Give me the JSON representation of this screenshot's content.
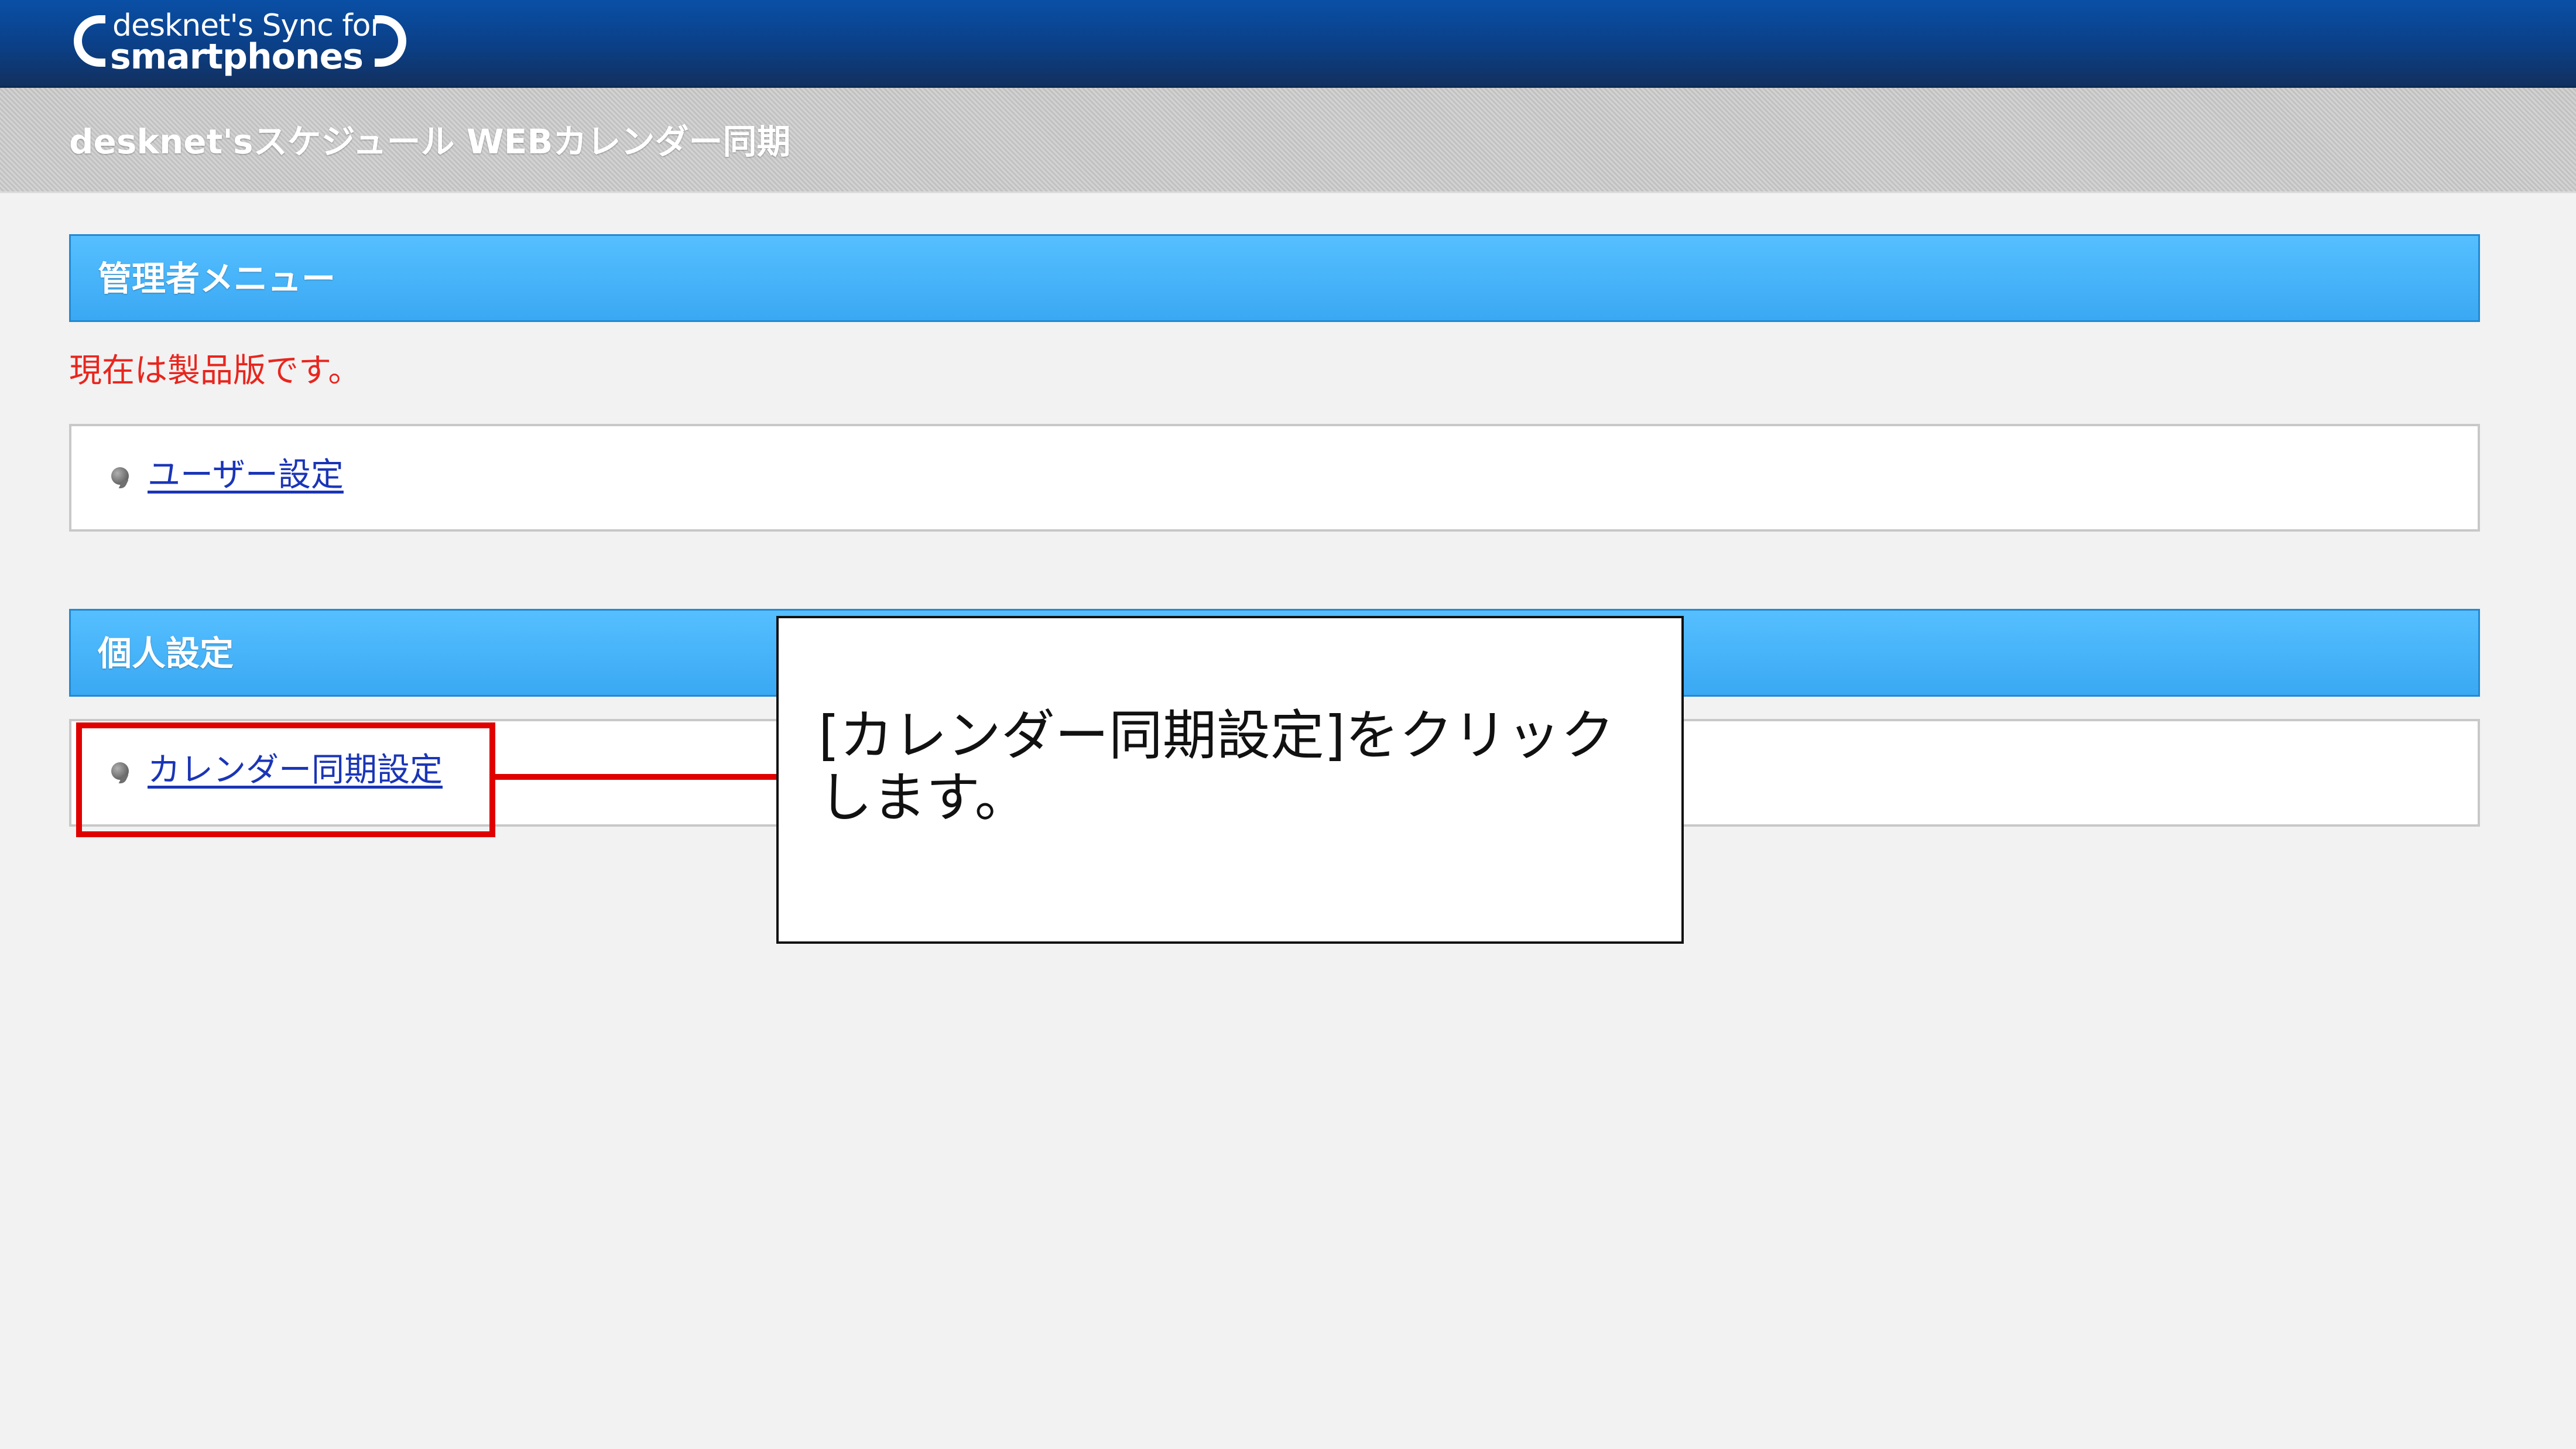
{
  "brand": {
    "logo_line1": "desknet's Sync for",
    "logo_line2": "smartphones"
  },
  "page": {
    "title": "desknet'sスケジュール WEBカレンダー同期"
  },
  "admin_menu": {
    "header": "管理者メニュー",
    "notice": "現在は製品版です。",
    "links": [
      {
        "label": "ユーザー設定",
        "icon": "bullet-icon"
      }
    ]
  },
  "personal_settings": {
    "header": "個人設定",
    "links": [
      {
        "label": "カレンダー同期設定",
        "icon": "bullet-icon"
      }
    ]
  },
  "annotation": {
    "callout_text": "[カレンダー同期設定]をクリックします。",
    "highlight_color": "#e00000"
  },
  "colors": {
    "header_blue": "#0b3f86",
    "section_blue": "#3aa8f3",
    "notice_red": "#e8261e",
    "link_blue": "#1a35b7"
  }
}
